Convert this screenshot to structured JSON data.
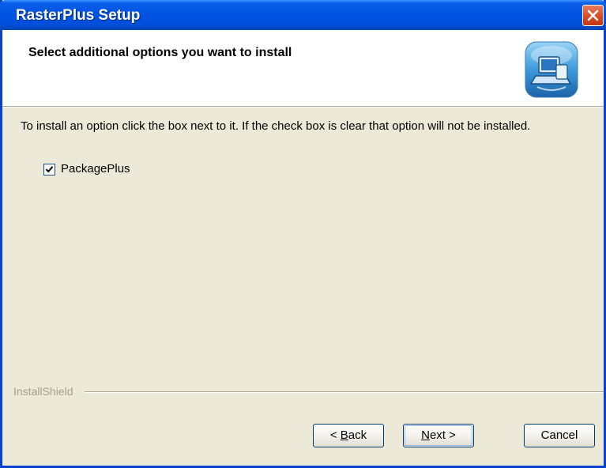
{
  "window": {
    "title": "RasterPlus Setup"
  },
  "header": {
    "title": "Select additional options you want to install",
    "icon": "setup-computer-icon"
  },
  "body": {
    "instructions": "To install an option click the box next to it. If the check box is clear that option will not be installed.",
    "options": [
      {
        "label": "PackagePlus",
        "checked": true
      }
    ]
  },
  "footer": {
    "brand": "InstallShield",
    "back": {
      "mnemonic": "B",
      "rest": "ack",
      "prefix": "< "
    },
    "next": {
      "mnemonic": "N",
      "rest": "ext",
      "suffix": " >"
    },
    "cancel": "Cancel"
  },
  "colors": {
    "title_bar": "#0054e3",
    "dialog_bg": "#ece9d8",
    "close_button": "#d9461f"
  }
}
